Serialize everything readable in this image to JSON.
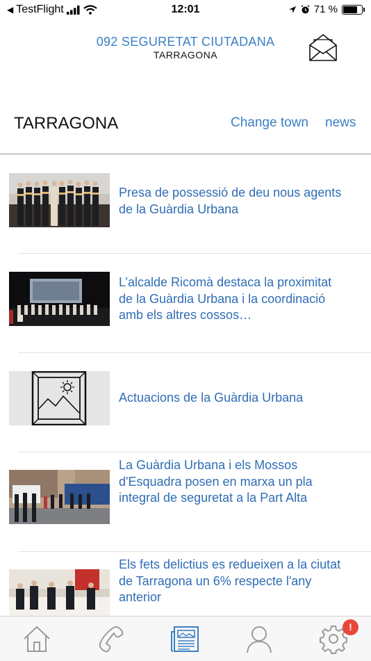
{
  "status_bar": {
    "back_app": "TestFlight",
    "time": "12:01",
    "battery": "71 %",
    "battery_level": 0.71
  },
  "header": {
    "title": "092 SEGURETAT CIUTADANA",
    "subtitle": "TARRAGONA"
  },
  "town_bar": {
    "town": "TARRAGONA",
    "change_town": "Change town",
    "news": "news"
  },
  "news": [
    {
      "title": "Presa de possessió de deu nous agents de la Guàrdia Urbana"
    },
    {
      "title": "L’alcalde Ricomà destaca la proximitat de la Guàrdia Urbana i la coordinació amb els altres cossos…"
    },
    {
      "title": "Actuacions de la Guàrdia Urbana"
    },
    {
      "title": "La Guàrdia Urbana i els Mossos d'Esquadra posen en marxa un pla integral de seguretat a la Part Alta"
    },
    {
      "title": "Els fets delictius es redueixen a la ciutat de Tarragona un 6% respecte l'any anterior"
    }
  ],
  "tabbar": {
    "tabs": [
      {
        "icon": "home-icon"
      },
      {
        "icon": "phone-icon"
      },
      {
        "icon": "newspaper-icon",
        "active": true
      },
      {
        "icon": "user-icon"
      },
      {
        "icon": "gear-icon"
      }
    ],
    "settings_badge": "!"
  },
  "colors": {
    "accent": "#3b7fc4",
    "badge": "#e8473b"
  }
}
